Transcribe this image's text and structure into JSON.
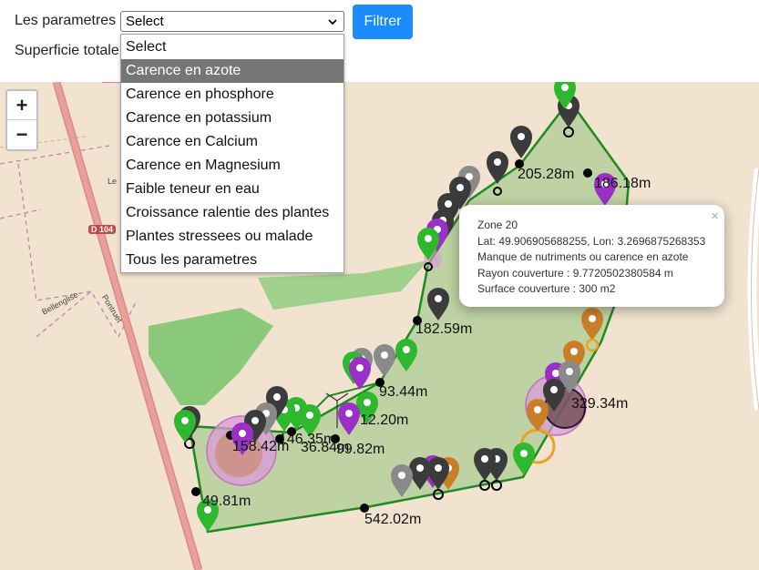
{
  "controls": {
    "param_label": "Les parametres",
    "select_value": "Select",
    "filter_label": "Filtrer",
    "surface_label": "Superficie totale"
  },
  "dropdown": {
    "options": [
      "Select",
      "Carence en azote",
      "Carence en phosphore",
      "Carence en potassium",
      "Carence en Calcium",
      "Carence en Magnesium",
      "Faible teneur en eau",
      "Croissance ralentie des plantes",
      "Plantes stressees ou malade",
      "Tous les parametres"
    ],
    "highlighted": "Carence en azote"
  },
  "map": {
    "zoom_in": "+",
    "zoom_out": "−",
    "road_badge": "D 104",
    "street_labels": [
      "Bellenglise",
      "Pontruet",
      "Le"
    ],
    "distances": [
      "205.28m",
      "186.18m",
      "182.59m",
      "93.44m",
      "12.20m",
      "329.34m",
      "158.42m",
      "146.35m",
      "36.84m",
      "99.82m",
      "49.81m",
      "542.02m"
    ],
    "colors": {
      "land": "#f1e3cf",
      "field_fill": "#b5cf9b",
      "field_border": "#1f8a1f",
      "park": "#8bc97a",
      "road": "#e8938f",
      "marker_black": "#3b3b3b",
      "marker_green": "#2eb82e",
      "marker_purple": "#9b30c8",
      "marker_orange": "#c97f2a",
      "marker_gray": "#8a8a8a"
    }
  },
  "popup": {
    "title": "Zone 20",
    "coords": "Lat: 49.906905688255, Lon: 3.2696875268353",
    "issue": "Manque de nutriments ou carence en azote",
    "radius": "Rayon couverture : 9.7720502380584 m",
    "surface": "Surface couverture : 300 m2",
    "close": "×"
  }
}
